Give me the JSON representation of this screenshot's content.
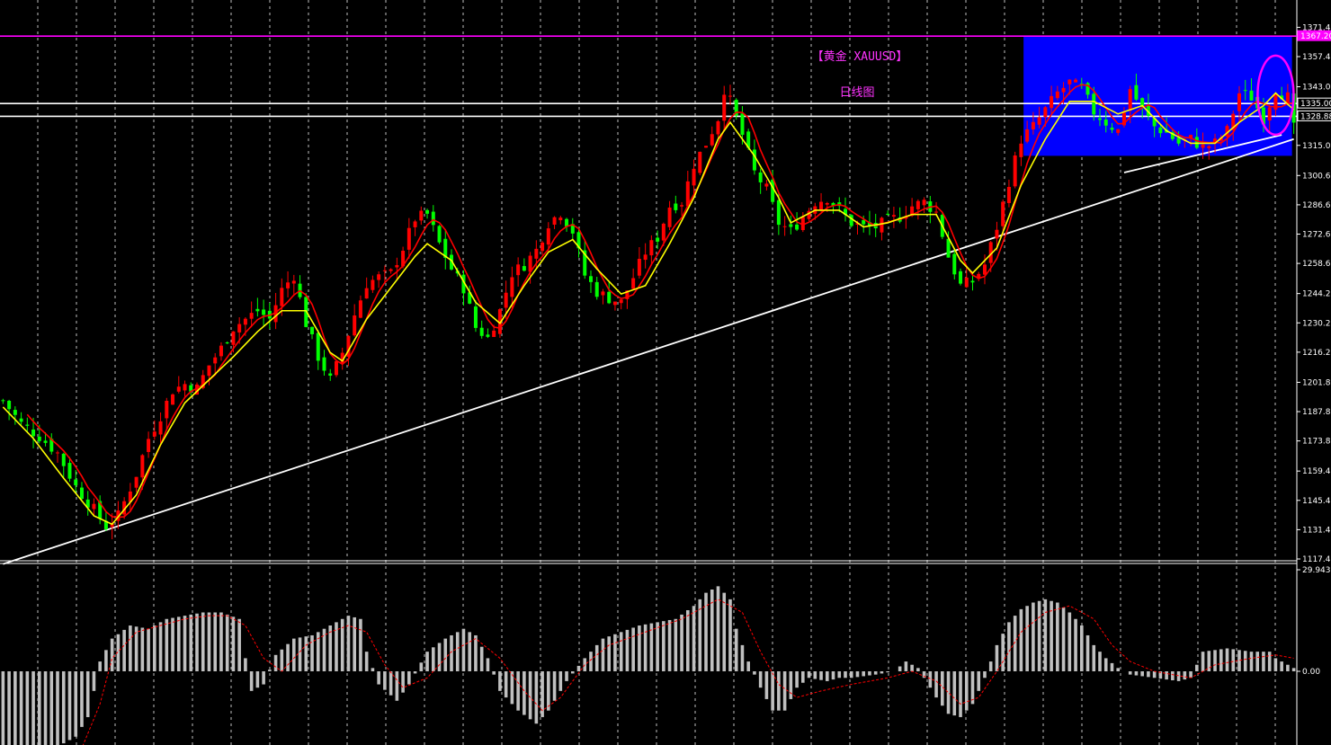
{
  "chart_data": {
    "type": "candlestick",
    "title": "【黄金 XAUUSD】",
    "subtitle": "日线图",
    "colors": {
      "background": "#000000",
      "up_candle": "#ff0000",
      "down_candle": "#00ff00",
      "ma_fast": "#ff0000",
      "ma_slow": "#ffff00",
      "resistance_line": "#ff00ff",
      "trendline": "#ffffff",
      "highlight_box": "#0000ff",
      "macd_bars": "#c0c0c0",
      "macd_signal": "#ff0000",
      "title": "#ff33ff",
      "grid": "#ffffff"
    },
    "price_axis": {
      "ylim": [
        1117.4,
        1375.0
      ],
      "tick_labels": [
        "1371.40",
        "1357.40",
        "1343.00",
        "1329.00",
        "1315.00",
        "1300.60",
        "1286.60",
        "1272.60",
        "1258.60",
        "1244.20",
        "1230.20",
        "1216.20",
        "1201.80",
        "1187.80",
        "1173.80",
        "1159.40",
        "1145.40",
        "1131.40",
        "1117.40"
      ],
      "tick_values": [
        1371.4,
        1357.4,
        1343.0,
        1329.0,
        1315.0,
        1300.6,
        1286.6,
        1272.6,
        1258.6,
        1244.2,
        1230.2,
        1216.2,
        1201.8,
        1187.8,
        1173.8,
        1159.4,
        1145.4,
        1131.4,
        1117.4
      ]
    },
    "price_markers": [
      {
        "label": "1367.20",
        "value": 1367.2,
        "color": "#ff00ff"
      },
      {
        "label": "1335.00",
        "value": 1335.0,
        "color": "#ffffff"
      },
      {
        "label": "1328.88",
        "value": 1328.88,
        "color": "#ffffff"
      }
    ],
    "grid": true,
    "close_path": [
      [
        0,
        1193
      ],
      [
        3,
        1182
      ],
      [
        6,
        1176
      ],
      [
        9,
        1168
      ],
      [
        12,
        1152
      ],
      [
        15,
        1141
      ],
      [
        17,
        1133
      ],
      [
        19,
        1138
      ],
      [
        22,
        1158
      ],
      [
        24,
        1175
      ],
      [
        26,
        1186
      ],
      [
        28,
        1198
      ],
      [
        30,
        1201
      ],
      [
        32,
        1199
      ],
      [
        34,
        1210
      ],
      [
        36,
        1218
      ],
      [
        38,
        1228
      ],
      [
        40,
        1232
      ],
      [
        42,
        1236
      ],
      [
        44,
        1232
      ],
      [
        46,
        1246
      ],
      [
        48,
        1253
      ],
      [
        50,
        1230
      ],
      [
        52,
        1214
      ],
      [
        54,
        1203
      ],
      [
        56,
        1216
      ],
      [
        58,
        1234
      ],
      [
        60,
        1249
      ],
      [
        62,
        1252
      ],
      [
        64,
        1254
      ],
      [
        66,
        1266
      ],
      [
        68,
        1280
      ],
      [
        70,
        1282
      ],
      [
        72,
        1268
      ],
      [
        74,
        1256
      ],
      [
        76,
        1247
      ],
      [
        78,
        1228
      ],
      [
        80,
        1223
      ],
      [
        82,
        1236
      ],
      [
        84,
        1254
      ],
      [
        86,
        1258
      ],
      [
        88,
        1265
      ],
      [
        90,
        1278
      ],
      [
        92,
        1283
      ],
      [
        94,
        1274
      ],
      [
        96,
        1253
      ],
      [
        98,
        1245
      ],
      [
        100,
        1242
      ],
      [
        102,
        1240
      ],
      [
        104,
        1252
      ],
      [
        106,
        1264
      ],
      [
        108,
        1271
      ],
      [
        110,
        1286
      ],
      [
        112,
        1288
      ],
      [
        114,
        1306
      ],
      [
        116,
        1316
      ],
      [
        118,
        1328
      ],
      [
        119,
        1342
      ],
      [
        120,
        1336
      ],
      [
        122,
        1320
      ],
      [
        124,
        1302
      ],
      [
        126,
        1294
      ],
      [
        128,
        1278
      ],
      [
        130,
        1274
      ],
      [
        132,
        1281
      ],
      [
        134,
        1288
      ],
      [
        136,
        1290
      ],
      [
        138,
        1284
      ],
      [
        140,
        1278
      ],
      [
        142,
        1276
      ],
      [
        144,
        1276
      ],
      [
        146,
        1279
      ],
      [
        148,
        1281
      ],
      [
        150,
        1286
      ],
      [
        152,
        1288
      ],
      [
        154,
        1283
      ],
      [
        156,
        1262
      ],
      [
        158,
        1248
      ],
      [
        160,
        1250
      ],
      [
        162,
        1258
      ],
      [
        164,
        1276
      ],
      [
        166,
        1298
      ],
      [
        168,
        1318
      ],
      [
        170,
        1324
      ],
      [
        172,
        1332
      ],
      [
        174,
        1340
      ],
      [
        176,
        1345
      ],
      [
        178,
        1342
      ],
      [
        180,
        1331
      ],
      [
        182,
        1326
      ],
      [
        184,
        1322
      ],
      [
        186,
        1342
      ],
      [
        188,
        1332
      ],
      [
        190,
        1324
      ],
      [
        192,
        1321
      ],
      [
        194,
        1316
      ],
      [
        196,
        1318
      ],
      [
        198,
        1314
      ],
      [
        200,
        1316
      ],
      [
        202,
        1322
      ],
      [
        204,
        1340
      ],
      [
        206,
        1338
      ],
      [
        208,
        1328
      ],
      [
        210,
        1342
      ],
      [
        212,
        1338
      ],
      [
        213,
        1323
      ]
    ],
    "ma_slow_path": [
      [
        0,
        1190
      ],
      [
        5,
        1175
      ],
      [
        10,
        1156
      ],
      [
        15,
        1138
      ],
      [
        18,
        1134
      ],
      [
        22,
        1148
      ],
      [
        26,
        1172
      ],
      [
        30,
        1192
      ],
      [
        34,
        1203
      ],
      [
        38,
        1214
      ],
      [
        42,
        1226
      ],
      [
        46,
        1236
      ],
      [
        50,
        1236
      ],
      [
        54,
        1216
      ],
      [
        56,
        1212
      ],
      [
        60,
        1232
      ],
      [
        64,
        1247
      ],
      [
        68,
        1262
      ],
      [
        70,
        1268
      ],
      [
        74,
        1260
      ],
      [
        78,
        1240
      ],
      [
        82,
        1230
      ],
      [
        86,
        1248
      ],
      [
        90,
        1264
      ],
      [
        94,
        1270
      ],
      [
        98,
        1256
      ],
      [
        102,
        1244
      ],
      [
        106,
        1248
      ],
      [
        110,
        1268
      ],
      [
        114,
        1290
      ],
      [
        118,
        1318
      ],
      [
        120,
        1326
      ],
      [
        124,
        1310
      ],
      [
        128,
        1290
      ],
      [
        130,
        1278
      ],
      [
        134,
        1284
      ],
      [
        138,
        1284
      ],
      [
        142,
        1276
      ],
      [
        146,
        1278
      ],
      [
        150,
        1282
      ],
      [
        154,
        1282
      ],
      [
        158,
        1260
      ],
      [
        160,
        1254
      ],
      [
        164,
        1266
      ],
      [
        168,
        1296
      ],
      [
        172,
        1318
      ],
      [
        176,
        1336
      ],
      [
        180,
        1336
      ],
      [
        184,
        1330
      ],
      [
        188,
        1334
      ],
      [
        192,
        1322
      ],
      [
        196,
        1316
      ],
      [
        200,
        1316
      ],
      [
        204,
        1326
      ],
      [
        208,
        1334
      ],
      [
        210,
        1340
      ],
      [
        213,
        1332
      ]
    ],
    "trendlines": [
      {
        "from": [
          0,
          1115
        ],
        "to": [
          213,
          1318
        ],
        "color": "#ffffff"
      },
      {
        "from": [
          185,
          1302
        ],
        "to": [
          211,
          1320
        ],
        "color": "#ffffff"
      }
    ],
    "horizontal_lines": [
      {
        "value": 1367.2,
        "color": "#ff00ff"
      },
      {
        "value": 1335.0,
        "color": "#ffffff"
      },
      {
        "value": 1328.88,
        "color": "#ffffff"
      }
    ],
    "highlight_box": {
      "x": [
        169,
        213
      ],
      "y": [
        1310,
        1367
      ],
      "color": "#0000ff"
    },
    "highlight_circle": {
      "x": 210,
      "y": 1339,
      "color": "#ff00ff"
    },
    "indicator": {
      "type": "macd",
      "tick_labels": [
        "29.943",
        "0.00"
      ],
      "tick_values": [
        29.943,
        0
      ],
      "ylim": [
        -25,
        29.943
      ],
      "histogram_path": [
        [
          0,
          -30
        ],
        [
          4,
          -28
        ],
        [
          8,
          -24
        ],
        [
          12,
          -20
        ],
        [
          14,
          -14
        ],
        [
          15,
          -6
        ],
        [
          16,
          3
        ],
        [
          18,
          10
        ],
        [
          21,
          14
        ],
        [
          24,
          13
        ],
        [
          27,
          16
        ],
        [
          30,
          17
        ],
        [
          33,
          18
        ],
        [
          36,
          18
        ],
        [
          39,
          16
        ],
        [
          40,
          4
        ],
        [
          41,
          -6
        ],
        [
          43,
          -4
        ],
        [
          45,
          5
        ],
        [
          48,
          10
        ],
        [
          51,
          11
        ],
        [
          54,
          14
        ],
        [
          57,
          17
        ],
        [
          59,
          16
        ],
        [
          60,
          6
        ],
        [
          62,
          -4
        ],
        [
          65,
          -9
        ],
        [
          67,
          -4
        ],
        [
          70,
          6
        ],
        [
          73,
          10
        ],
        [
          76,
          13
        ],
        [
          78,
          11
        ],
        [
          80,
          4
        ],
        [
          82,
          -6
        ],
        [
          85,
          -12
        ],
        [
          88,
          -16
        ],
        [
          90,
          -12
        ],
        [
          93,
          -3
        ],
        [
          96,
          4
        ],
        [
          99,
          10
        ],
        [
          102,
          12
        ],
        [
          105,
          14
        ],
        [
          108,
          15
        ],
        [
          111,
          16
        ],
        [
          114,
          20
        ],
        [
          116,
          24
        ],
        [
          118,
          26
        ],
        [
          120,
          22
        ],
        [
          121,
          13
        ],
        [
          123,
          3
        ],
        [
          125,
          -5
        ],
        [
          127,
          -12
        ],
        [
          129,
          -12
        ],
        [
          131,
          -5
        ],
        [
          133,
          -2
        ],
        [
          136,
          -3
        ],
        [
          138,
          -2
        ],
        [
          140,
          -2
        ],
        [
          144,
          -1
        ],
        [
          147,
          0
        ],
        [
          149,
          3
        ],
        [
          151,
          1
        ],
        [
          152,
          -2
        ],
        [
          154,
          -8
        ],
        [
          156,
          -13
        ],
        [
          158,
          -14
        ],
        [
          160,
          -10
        ],
        [
          162,
          -2
        ],
        [
          164,
          8
        ],
        [
          166,
          15
        ],
        [
          168,
          19
        ],
        [
          170,
          21
        ],
        [
          172,
          22
        ],
        [
          174,
          21
        ],
        [
          176,
          18
        ],
        [
          178,
          14
        ],
        [
          180,
          8
        ],
        [
          182,
          4
        ],
        [
          184,
          1
        ],
        [
          186,
          -1
        ],
        [
          190,
          -2
        ],
        [
          194,
          -3
        ],
        [
          196,
          -2
        ],
        [
          198,
          6
        ],
        [
          202,
          7
        ],
        [
          206,
          6
        ],
        [
          209,
          6
        ],
        [
          210,
          4
        ],
        [
          212,
          2
        ],
        [
          213,
          1
        ]
      ],
      "signal_path": [
        [
          12,
          -28
        ],
        [
          16,
          -10
        ],
        [
          18,
          4
        ],
        [
          22,
          12
        ],
        [
          26,
          14
        ],
        [
          30,
          16
        ],
        [
          34,
          17
        ],
        [
          37,
          17
        ],
        [
          40,
          14
        ],
        [
          43,
          4
        ],
        [
          46,
          0
        ],
        [
          50,
          8
        ],
        [
          54,
          12
        ],
        [
          57,
          14
        ],
        [
          60,
          12
        ],
        [
          63,
          2
        ],
        [
          66,
          -5
        ],
        [
          70,
          -2
        ],
        [
          74,
          6
        ],
        [
          78,
          10
        ],
        [
          82,
          4
        ],
        [
          86,
          -6
        ],
        [
          89,
          -12
        ],
        [
          92,
          -8
        ],
        [
          96,
          2
        ],
        [
          100,
          8
        ],
        [
          106,
          12
        ],
        [
          112,
          16
        ],
        [
          118,
          22
        ],
        [
          122,
          18
        ],
        [
          125,
          6
        ],
        [
          128,
          -4
        ],
        [
          131,
          -8
        ],
        [
          135,
          -6
        ],
        [
          140,
          -4
        ],
        [
          146,
          -2
        ],
        [
          150,
          0
        ],
        [
          154,
          -3
        ],
        [
          158,
          -10
        ],
        [
          161,
          -8
        ],
        [
          164,
          0
        ],
        [
          168,
          12
        ],
        [
          172,
          18
        ],
        [
          176,
          20
        ],
        [
          180,
          16
        ],
        [
          183,
          8
        ],
        [
          186,
          3
        ],
        [
          190,
          0
        ],
        [
          196,
          -2
        ],
        [
          200,
          2
        ],
        [
          206,
          4
        ],
        [
          210,
          5
        ],
        [
          213,
          4
        ]
      ]
    }
  }
}
